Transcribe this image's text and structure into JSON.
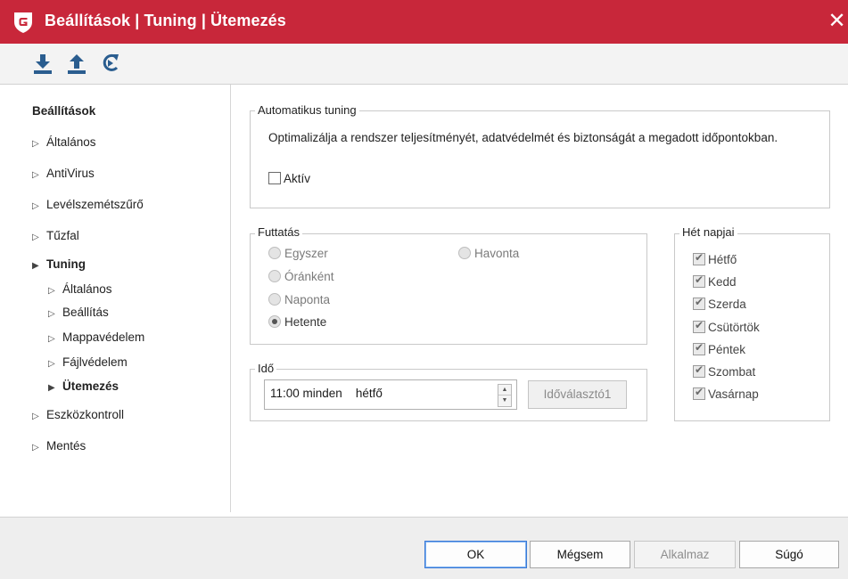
{
  "window": {
    "title": "Beállítások | Tuning | Ütemezés",
    "close_glyph": "✕",
    "accent_color": "#c8273a"
  },
  "toolbar": {
    "icons": [
      "import-icon",
      "export-icon",
      "reset-icon"
    ]
  },
  "sidebar": {
    "header": "Beállítások",
    "items": [
      {
        "label": "Általános"
      },
      {
        "label": "AntiVirus"
      },
      {
        "label": "Levélszemétszűrő"
      },
      {
        "label": "Tűzfal"
      },
      {
        "label": "Tuning",
        "expanded": true
      },
      {
        "label": "Általános"
      },
      {
        "label": "Beállítás"
      },
      {
        "label": "Mappavédelem"
      },
      {
        "label": "Fájlvédelem"
      },
      {
        "label": "Ütemezés",
        "selected": true
      },
      {
        "label": "Eszközkontroll"
      },
      {
        "label": "Mentés"
      }
    ],
    "arrow_collapsed": "▷",
    "arrow_expanded": "▶"
  },
  "auto_tuning": {
    "legend": "Automatikus tuning",
    "description": "Optimalizálja a rendszer teljesítményét, adatvédelmét és biztonságát a megadott időpontokban.",
    "active_label": "Aktív",
    "active_checked": false
  },
  "run": {
    "legend": "Futtatás",
    "options": [
      {
        "label": "Egyszer",
        "selected": false
      },
      {
        "label": "Óránként",
        "selected": false
      },
      {
        "label": "Naponta",
        "selected": false
      },
      {
        "label": "Hetente",
        "selected": true
      },
      {
        "label": "Havonta",
        "selected": false
      }
    ]
  },
  "time": {
    "legend": "Idő",
    "value_time": "11:00 minden",
    "value_day": "hétfő",
    "picker_button": "Időválasztó1",
    "spin_up": "▲",
    "spin_down": "▼"
  },
  "weekdays": {
    "legend": "Hét napjai",
    "days": [
      {
        "label": "Hétfő",
        "checked": true
      },
      {
        "label": "Kedd",
        "checked": true
      },
      {
        "label": "Szerda",
        "checked": true
      },
      {
        "label": "Csütörtök",
        "checked": true
      },
      {
        "label": "Péntek",
        "checked": true
      },
      {
        "label": "Szombat",
        "checked": true
      },
      {
        "label": "Vasárnap",
        "checked": true
      }
    ]
  },
  "footer": {
    "ok": "OK",
    "cancel": "Mégsem",
    "apply": "Alkalmaz",
    "help": "Súgó"
  }
}
